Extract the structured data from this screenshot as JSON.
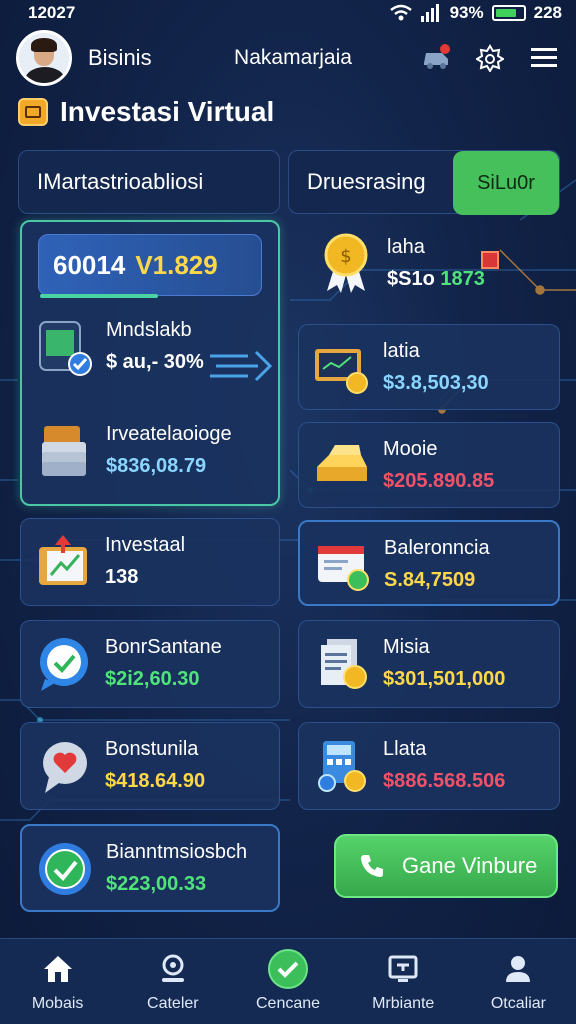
{
  "status_bar": {
    "time": "12027",
    "battery": "93%",
    "extra": "228"
  },
  "header": {
    "brand": "Bisinis",
    "title": "Nakamarjaia"
  },
  "section": {
    "title": "Investasi Virtual"
  },
  "tabs": {
    "left": "IMartastrioabliosi",
    "right": "Druesrasing",
    "right_button": "SiLu0r"
  },
  "balance": {
    "value": "60014",
    "secondary": "V1.829"
  },
  "left_items": [
    {
      "label": "Mndslakb",
      "value": "$ au,- 30%"
    },
    {
      "label": "Irveatelaoioge",
      "value": "$836,08.79"
    },
    {
      "label": "Investaal",
      "value": "138"
    },
    {
      "label": "BonrSantane",
      "value": "$2i2,60.30"
    },
    {
      "label": "Bonstunila",
      "value": "$418.64.90"
    },
    {
      "label": "Bianntmsiosbch",
      "value": "$223,00.33"
    }
  ],
  "right_items": [
    {
      "label": "laha",
      "value_a": "$S1o",
      "value_b": "1873"
    },
    {
      "label": "latia",
      "value": "$3.8,503,30"
    },
    {
      "label": "Mooie",
      "value": "$205.890.85"
    },
    {
      "label": "Baleronncia",
      "value": "S.84,7509"
    },
    {
      "label": "Misia",
      "value": "$301,501,000"
    },
    {
      "label": "Llata",
      "value": "$886.568.506"
    }
  ],
  "call_button": {
    "label": "Gane Vinbure"
  },
  "bottom_nav": [
    {
      "label": "Mobais",
      "icon": "home-icon"
    },
    {
      "label": "Cateler",
      "icon": "user-pin-icon"
    },
    {
      "label": "Cencane",
      "icon": "check-circle-icon"
    },
    {
      "label": "Mrbiante",
      "icon": "monitor-icon"
    },
    {
      "label": "Otcaliar",
      "icon": "profile-icon"
    }
  ],
  "colors": {
    "accent_green": "#45c05a",
    "positive": "#4fe37a",
    "negative": "#f1526a",
    "highlight": "#ffd84a",
    "background": "#12244a"
  }
}
